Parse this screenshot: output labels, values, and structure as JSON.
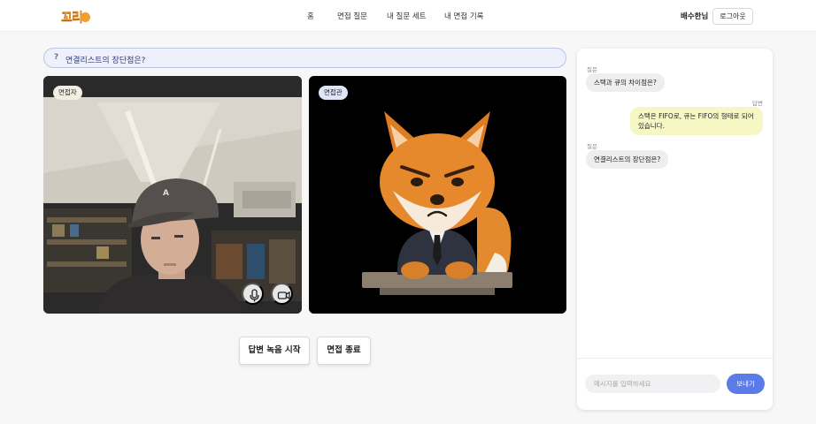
{
  "header": {
    "logo_text": "꼬리",
    "nav": [
      "홈",
      "면접 질문",
      "내 질문 세트",
      "내 면접 기록"
    ],
    "user_name": "배수한님",
    "logout_label": "로그아웃"
  },
  "question": {
    "icon": "?",
    "text": "연결리스트의 장단점은?"
  },
  "video": {
    "user_tag": "면접자",
    "interviewer_tag": "면접관"
  },
  "controls": {
    "record_label": "답변 녹음 시작",
    "end_label": "면접 종료"
  },
  "chat": {
    "messages": [
      {
        "role_label": "질문",
        "text": "스택과 큐의 차이점은?"
      },
      {
        "role_label": "답변",
        "text": "스택은 FIFO로, 큐는 FIFO의 형태로 되어있습니다."
      },
      {
        "role_label": "질문",
        "text": "연결리스트의 장단점은?"
      }
    ],
    "input_placeholder": "메시지를 입력하세요",
    "send_label": "보내기"
  },
  "colors": {
    "accent": "#5b7be8",
    "answer_bubble": "#f7f7c6",
    "question_banner": "#eef1fb"
  }
}
